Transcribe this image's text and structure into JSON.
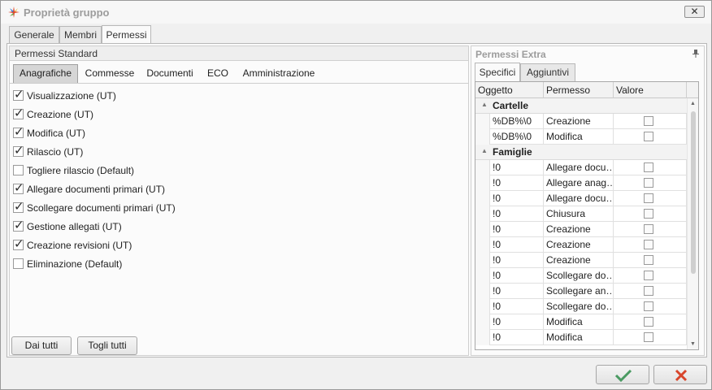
{
  "window": {
    "title": "Proprietà gruppo",
    "close_glyph": "✕"
  },
  "top_tabs": [
    "Generale",
    "Membri",
    "Permessi"
  ],
  "standard": {
    "header": "Permessi Standard",
    "subtabs": [
      "Anagrafiche",
      "Commesse",
      "Documenti",
      "ECO",
      "Amministrazione"
    ],
    "permissions": [
      {
        "label": "Visualizzazione (UT)",
        "checked": true
      },
      {
        "label": "Creazione (UT)",
        "checked": true
      },
      {
        "label": "Modifica (UT)",
        "checked": true
      },
      {
        "label": "Rilascio (UT)",
        "checked": true
      },
      {
        "label": "Togliere rilascio (Default)",
        "checked": false
      },
      {
        "label": "Allegare documenti primari (UT)",
        "checked": true
      },
      {
        "label": "Scollegare documenti primari (UT)",
        "checked": true
      },
      {
        "label": "Gestione allegati (UT)",
        "checked": true
      },
      {
        "label": "Creazione revisioni (UT)",
        "checked": true
      },
      {
        "label": "Eliminazione (Default)",
        "checked": false
      }
    ],
    "give_all": "Dai tutti",
    "remove_all": "Togli tutti"
  },
  "extra": {
    "header": "Permessi Extra",
    "pin_glyph": "📌",
    "tabs": [
      "Specifici",
      "Aggiuntivi"
    ],
    "columns": [
      "Oggetto",
      "Permesso",
      "Valore"
    ],
    "groups": [
      {
        "name": "Cartelle",
        "rows": [
          {
            "object": "%DB%\\0",
            "permission": "Creazione",
            "value": false
          },
          {
            "object": "%DB%\\0",
            "permission": "Modifica",
            "value": false
          }
        ]
      },
      {
        "name": "Famiglie",
        "rows": [
          {
            "object": "!0",
            "permission": "Allegare docu…",
            "value": false
          },
          {
            "object": "!0",
            "permission": "Allegare anag…",
            "value": false
          },
          {
            "object": "!0",
            "permission": "Allegare docu…",
            "value": false
          },
          {
            "object": "!0",
            "permission": "Chiusura",
            "value": false
          },
          {
            "object": "!0",
            "permission": "Creazione",
            "value": false
          },
          {
            "object": "!0",
            "permission": "Creazione",
            "value": false
          },
          {
            "object": "!0",
            "permission": "Creazione",
            "value": false
          },
          {
            "object": "!0",
            "permission": "Scollegare do…",
            "value": false
          },
          {
            "object": "!0",
            "permission": "Scollegare an…",
            "value": false
          },
          {
            "object": "!0",
            "permission": "Scollegare do…",
            "value": false
          },
          {
            "object": "!0",
            "permission": "Modifica",
            "value": false
          },
          {
            "object": "!0",
            "permission": "Modifica",
            "value": false
          }
        ]
      }
    ]
  },
  "footer": {
    "ok_icon": "check-icon",
    "cancel_icon": "cross-icon",
    "ok_color": "#4a9a62",
    "cancel_color": "#d8452b"
  }
}
